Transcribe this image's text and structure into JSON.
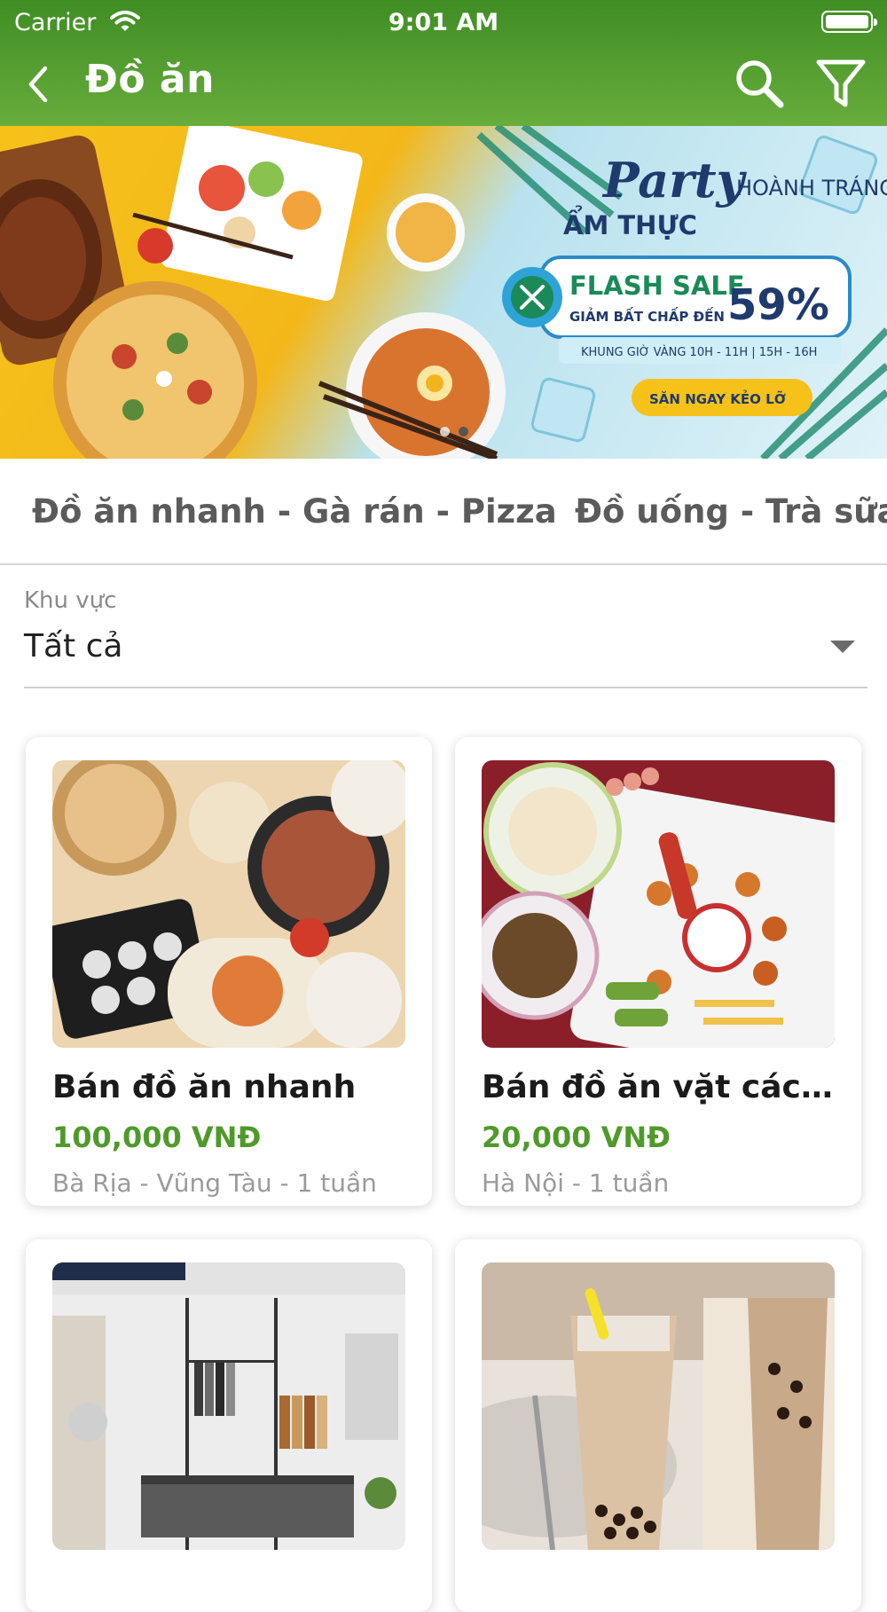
{
  "status_bar": {
    "carrier": "Carrier",
    "time": "9:01 AM"
  },
  "nav": {
    "title": "Đồ ăn",
    "icons": [
      "back-chevron-icon",
      "search-icon",
      "filter-icon"
    ]
  },
  "banner": {
    "line1": "Party",
    "line2": "ẨM THỰC",
    "line3": "HOÀNH TRÁNG",
    "sale_title": "FLASH SALE",
    "sale_sub": "GIẢM BẤT CHẤP ĐẾN",
    "sale_percent": "59%",
    "hours": "KHUNG GIỜ VÀNG 10H - 11H | 15H - 16H",
    "cta": "SĂN NGAY KẺO LỠ",
    "slide_count": 2,
    "active_slide": 2
  },
  "tabs": [
    "Đồ ăn nhanh - Gà rán - Pizza",
    "Đồ uống - Trà sữa"
  ],
  "filter": {
    "label": "Khu vực",
    "value": "Tất cả"
  },
  "products": [
    {
      "name": "Bán đồ ăn nhanh",
      "price": "100,000 VNĐ",
      "meta": "Bà Rịa - Vũng Tàu - 1 tuần"
    },
    {
      "name": "Bán đồ ăn vặt các loại",
      "price": "20,000 VNĐ",
      "meta": "Hà Nội - 1 tuần"
    },
    {
      "name": "",
      "price": "",
      "meta": ""
    },
    {
      "name": "",
      "price": "",
      "meta": ""
    }
  ],
  "colors": {
    "header": "#5ea536",
    "price": "#4f9a2b"
  }
}
